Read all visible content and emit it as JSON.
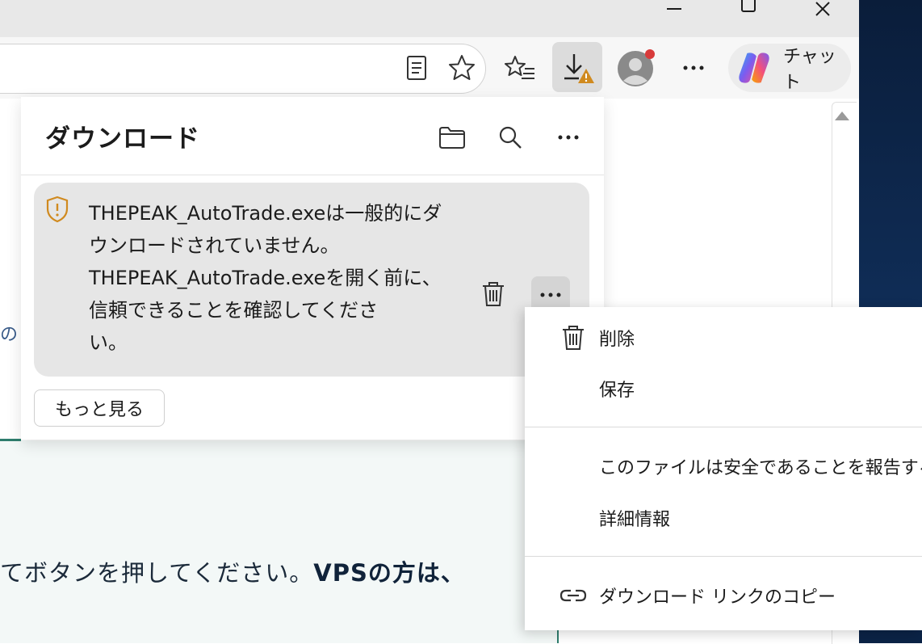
{
  "colors": {
    "warning_accent": "#d08a1f",
    "profile_badge": "#d83b3b",
    "panel_card": "#e6e6e6"
  },
  "window_controls": [
    "minimize-icon",
    "maximize-icon",
    "close-icon"
  ],
  "toolbar": {
    "icons": [
      "reading-view-icon",
      "favorite-star-icon",
      "favorites-list-icon",
      "download-warning-icon",
      "profile-icon",
      "more-icon",
      "copilot-icon"
    ],
    "chat_label": "チャット"
  },
  "downloads": {
    "title": "ダウンロード",
    "header_icons": [
      "folder-icon",
      "search-icon",
      "more-icon"
    ],
    "warning": {
      "lines": [
        "THEPEAK_AutoTrade.exeは一般的にダ",
        "ウンロードされていません。",
        "THEPEAK_AutoTrade.exeを開く前に、",
        "信頼できることを確認してくださ",
        "い。"
      ]
    },
    "see_more": "もっと見る"
  },
  "context_menu": {
    "items": [
      {
        "label": "削除",
        "icon": "trash-icon"
      },
      {
        "label": "保存",
        "icon": ""
      },
      {
        "label": "このファイルは安全であることを報告する",
        "icon": ""
      },
      {
        "label": "詳細情報",
        "icon": ""
      },
      {
        "label": "ダウンロード リンクのコピー",
        "icon": "link-icon"
      }
    ]
  },
  "page": {
    "fragment": "の I",
    "text_normal": "てボタンを押してください。",
    "text_bold": "VPSの方は、"
  }
}
